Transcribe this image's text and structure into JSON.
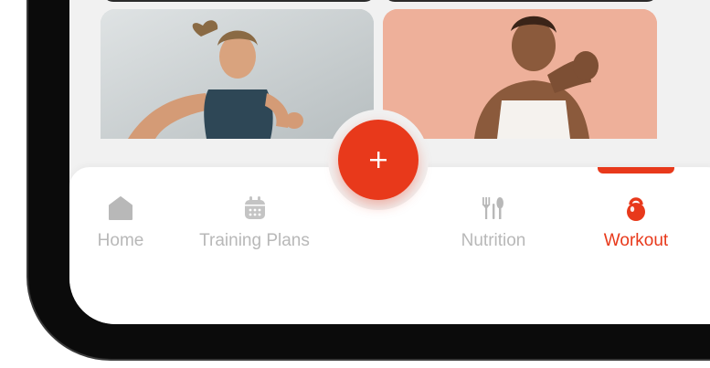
{
  "nav": {
    "items": [
      {
        "label": "Home",
        "icon": "home-icon",
        "active": false
      },
      {
        "label": "Training Plans",
        "icon": "calendar-icon",
        "active": false
      },
      {
        "label": "Nutrition",
        "icon": "utensils-icon",
        "active": false
      },
      {
        "label": "Workout",
        "icon": "kettlebell-icon",
        "active": true
      }
    ],
    "fab_icon": "plus-icon"
  },
  "colors": {
    "accent": "#e8391b",
    "inactive": "#b8b8b8",
    "screen_bg": "#f1f1f1",
    "frame": "#0b0b0b"
  },
  "cards": [
    {
      "image": "woman-running-photo"
    },
    {
      "image": "woman-boxing-stance-photo"
    }
  ]
}
